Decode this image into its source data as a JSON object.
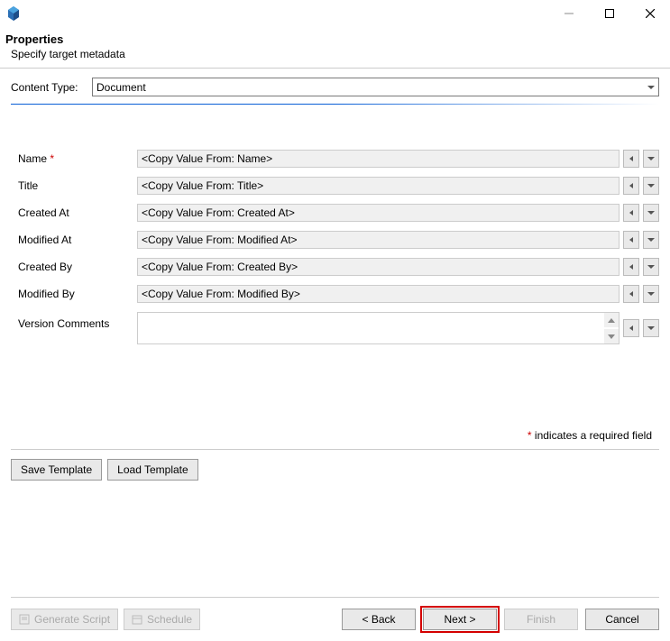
{
  "header": {
    "title": "Properties",
    "subtitle": "Specify target metadata"
  },
  "contentType": {
    "label": "Content Type:",
    "value": "Document"
  },
  "fields": [
    {
      "label": "Name",
      "required": true,
      "value": "<Copy Value From: Name>"
    },
    {
      "label": "Title",
      "required": false,
      "value": "<Copy Value From: Title>"
    },
    {
      "label": "Created At",
      "required": false,
      "value": "<Copy Value From: Created At>"
    },
    {
      "label": "Modified At",
      "required": false,
      "value": "<Copy Value From: Modified At>"
    },
    {
      "label": "Created By",
      "required": false,
      "value": "<Copy Value From: Created By>"
    },
    {
      "label": "Modified By",
      "required": false,
      "value": "<Copy Value From: Modified By>"
    }
  ],
  "versionComments": {
    "label": "Version Comments",
    "value": ""
  },
  "requiredNote": {
    "asterisk": "*",
    "text": " indicates a required field"
  },
  "templateButtons": {
    "save": "Save Template",
    "load": "Load Template"
  },
  "footerButtons": {
    "generateScript": "Generate Script",
    "schedule": "Schedule",
    "back": "< Back",
    "next": "Next >",
    "finish": "Finish",
    "cancel": "Cancel"
  }
}
